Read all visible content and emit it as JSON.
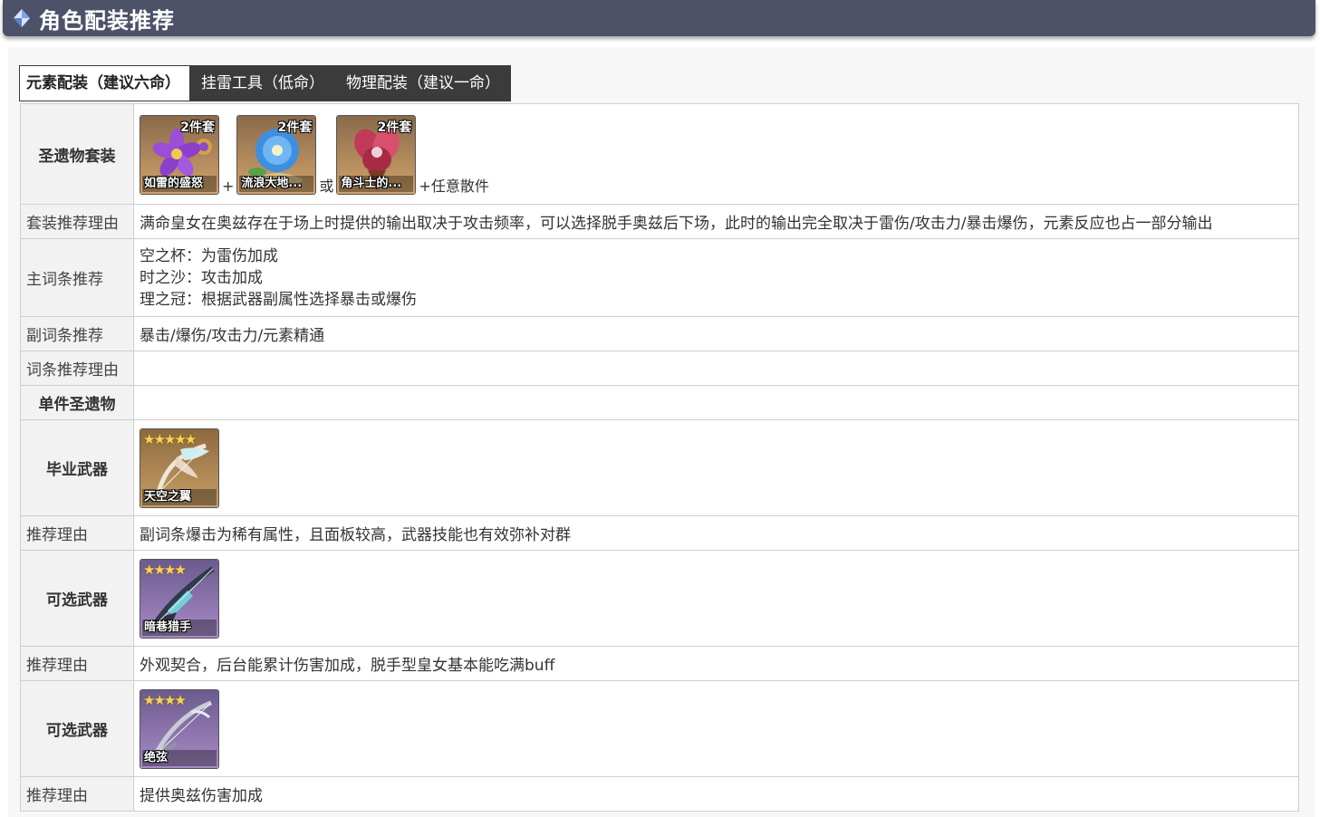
{
  "header": {
    "title": "角色配装推荐"
  },
  "tabs": [
    {
      "label": "元素配装（建议六命）",
      "active": true
    },
    {
      "label": "挂雷工具（低命）",
      "active": false
    },
    {
      "label": "物理配装（建议一命）",
      "active": false
    }
  ],
  "rows": {
    "artifact_set": {
      "label": "圣遗物套装",
      "items": [
        {
          "badge": "2件套",
          "name": "如雷的盛怒"
        },
        {
          "badge": "2件套",
          "name": "流浪大地..."
        },
        {
          "badge": "2件套",
          "name": "角斗士的..."
        }
      ],
      "sep_plus": "+",
      "sep_or": "或",
      "suffix": "+任意散件"
    },
    "set_reason": {
      "label": "套装推荐理由",
      "text": "满命皇女在奥兹存在于场上时提供的输出取决于攻击频率，可以选择脱手奥兹后下场，此时的输出完全取决于雷伤/攻击力/暴击爆伤，元素反应也占一部分输出"
    },
    "main_stats": {
      "label": "主词条推荐",
      "lines": [
        "空之杯：为雷伤加成",
        "时之沙：攻击加成",
        "理之冠：根据武器副属性选择暴击或爆伤"
      ]
    },
    "sub_stats": {
      "label": "副词条推荐",
      "text": "暴击/爆伤/攻击力/元素精通"
    },
    "sub_reason": {
      "label": "词条推荐理由",
      "text": ""
    },
    "single_artifact": {
      "label": "单件圣遗物",
      "text": ""
    },
    "best_weapon": {
      "label": "毕业武器",
      "stars": "★★★★★",
      "name": "天空之翼"
    },
    "best_reason": {
      "label": "推荐理由",
      "text": "副词条爆击为稀有属性，且面板较高，武器技能也有效弥补对群"
    },
    "alt_weapon_1": {
      "label": "可选武器",
      "stars": "★★★★",
      "name": "暗巷猎手"
    },
    "alt_reason_1": {
      "label": "推荐理由",
      "text": "外观契合，后台能累计伤害加成，脱手型皇女基本能吃满buff"
    },
    "alt_weapon_2": {
      "label": "可选武器",
      "stars": "★★★★",
      "name": "绝弦"
    },
    "alt_reason_2": {
      "label": "推荐理由",
      "text": "提供奥兹伤害加成"
    }
  }
}
